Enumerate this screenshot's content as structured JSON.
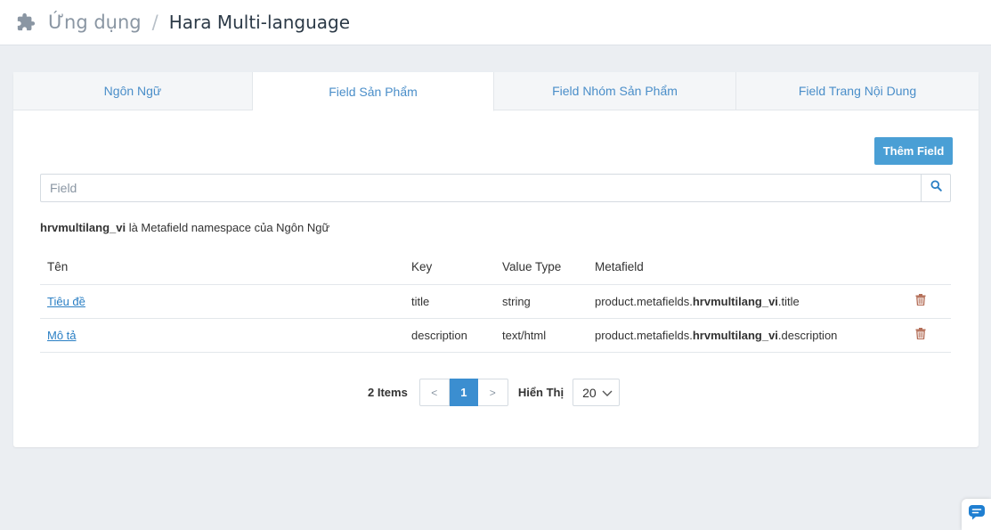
{
  "header": {
    "icon": "puzzle-icon",
    "parent": "Ứng dụng",
    "separator": "/",
    "current": "Hara Multi-language"
  },
  "tabs": [
    {
      "label": "Ngôn Ngữ",
      "active": false
    },
    {
      "label": "Field Sản Phẩm",
      "active": true
    },
    {
      "label": "Field Nhóm Sản Phẩm",
      "active": false
    },
    {
      "label": "Field Trang Nội Dung",
      "active": false
    }
  ],
  "toolbar": {
    "add_label": "Thêm Field"
  },
  "search": {
    "placeholder": "Field",
    "value": "",
    "icon": "search-icon"
  },
  "note": {
    "namespace": "hrvmultilang_vi",
    "text": " là Metafield namespace của Ngôn Ngữ"
  },
  "table": {
    "headers": [
      "Tên",
      "Key",
      "Value Type",
      "Metafield"
    ],
    "rows": [
      {
        "name": "Tiêu đề",
        "key": "title",
        "type": "string",
        "mf_prefix": "product.metafields.",
        "mf_ns": "hrvmultilang_vi",
        "mf_suffix": ".title"
      },
      {
        "name": "Mô tả",
        "key": "description",
        "type": "text/html",
        "mf_prefix": "product.metafields.",
        "mf_ns": "hrvmultilang_vi",
        "mf_suffix": ".description"
      }
    ]
  },
  "pagination": {
    "count": "2 Items",
    "prev": "<",
    "current": "1",
    "next": ">",
    "show_label": "Hiển Thị",
    "per_page": "20"
  },
  "colors": {
    "accent": "#4a9fd5",
    "link": "#2a7fc4",
    "trash": "#b5705a"
  }
}
